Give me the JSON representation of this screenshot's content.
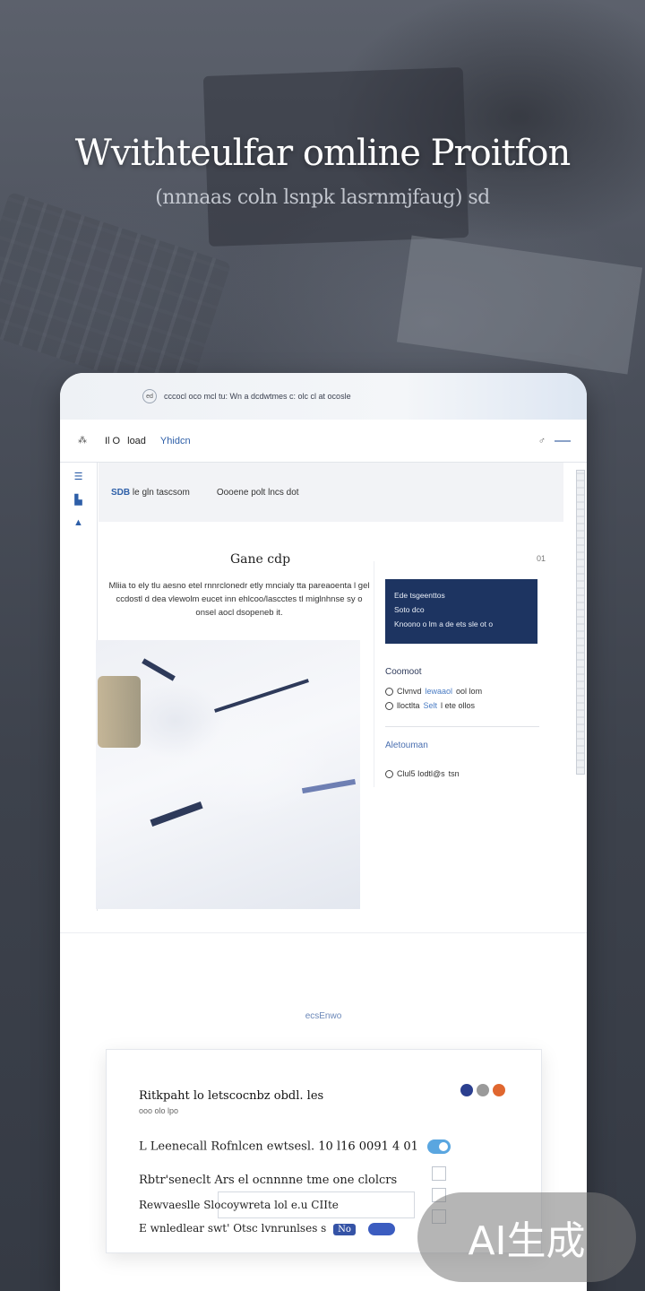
{
  "hero": {
    "title": "Wvithteulfar omline Proitfon",
    "subtitle": "(nnnaas coln lsnpk lasrnmjfaug) sd"
  },
  "device": {
    "topbar_text": "cccocl oco mcl tu: Wn a dcdwtmes c: olc cl at ocosle",
    "logo_glyph": "ed",
    "nav": {
      "items": [
        "Il O",
        "load",
        "Yhidcn"
      ],
      "active_index": 2
    },
    "content_header": {
      "badge": "SDB",
      "text_1": "le gln tascsom",
      "text_2": "Oooene polt lncs dot"
    },
    "page": {
      "heading": "Gane cdp",
      "page_num": "01",
      "intro": "Mliia to ely tlu aesno etel rnnrclonedr etly mncialy tta pareaoenta l gel ccdostl d dea vlewolm eucet inn ehlcoo/lascctes tl miglnhnse sy o onsel aocl dsopeneb it."
    },
    "panel": {
      "card_line_1": "Ede tsgeenttos",
      "card_line_2": "Soto dco",
      "card_line_3": "Knoono o lm a de ets sle ot o",
      "section_1": "Coomoot",
      "option_1": "Clvnvd",
      "option_1_hl": "lewaaol",
      "option_1_tail": "ool lom",
      "option_2": "lloctlta",
      "option_2_hl": "Selt",
      "option_2_tail": "l ete ollos",
      "section_2": "Aletouman",
      "option_3": "Clul5 Iodtl@s",
      "option_3_tail": "tsn"
    },
    "section_label": "ecsEnwo",
    "form": {
      "title": "Ritkpaht lo letscocnbz obdl. les",
      "subtitle": "ooo olo lpo",
      "row_1_label": "L Leenecall Rofnlcen ewtsesl.",
      "row_1_num": "10 l16 0091 4 01",
      "row_2": "Rbtr'seneclt Ars el ocnnnne tme one clolcrs",
      "row_3": "Rewvaeslle  Slocoywreta lol e.u CIIte",
      "row_4": "E wnledlear swt' Otsc lvnrunlses s",
      "row_4_pill": "No",
      "dot_colors": [
        "#2b3f8f",
        "#9a9a9a",
        "#e0672f"
      ]
    }
  },
  "watermark": "AI生成"
}
